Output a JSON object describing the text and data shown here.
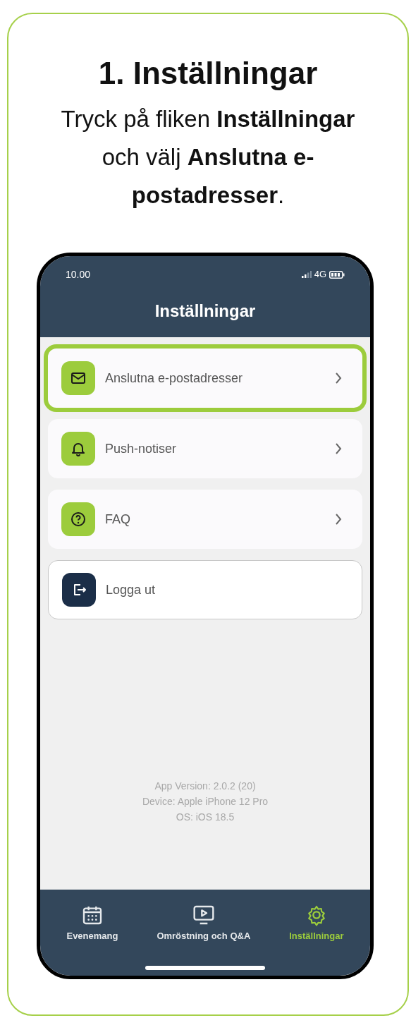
{
  "instruction": {
    "title": "1. Inställningar",
    "text": "Tryck på fliken **Inställningar** och välj **Anslutna e-postadresser**."
  },
  "phone": {
    "status_bar": {
      "time": "10.00",
      "network": "4G"
    },
    "header": {
      "title": "Inställningar"
    },
    "menu_items": [
      {
        "label": "Anslutna e-postadresser",
        "kind": "link",
        "highlighted": true
      },
      {
        "label": "Push-notiser",
        "kind": "link",
        "highlighted": false
      },
      {
        "label": "FAQ",
        "kind": "link",
        "highlighted": false
      },
      {
        "label": "Logga ut",
        "kind": "logout",
        "highlighted": false
      }
    ],
    "app_info": [
      "App Version: 2.0.2 (20)",
      "Device: Apple iPhone 12 Pro",
      "OS: iOS 18.5"
    ],
    "tab_bar": [
      {
        "label": "Evenemang",
        "selected": false
      },
      {
        "label": "Omröstning och Q&A",
        "selected": false
      },
      {
        "label": "Inställningar",
        "selected": true
      }
    ]
  }
}
